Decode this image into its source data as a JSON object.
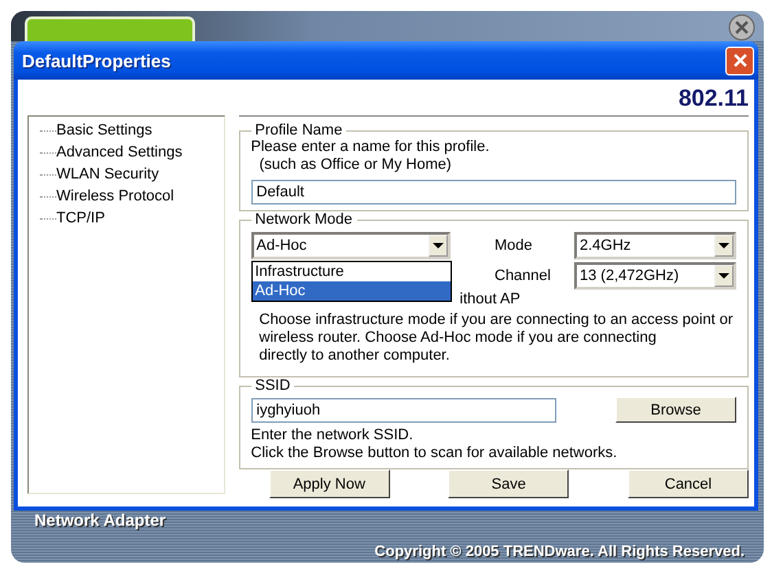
{
  "window": {
    "title": "DefaultProperties",
    "standard": "802.11"
  },
  "sidebar": {
    "items": [
      {
        "label": "Basic Settings"
      },
      {
        "label": "Advanced Settings"
      },
      {
        "label": "WLAN Security"
      },
      {
        "label": "Wireless Protocol"
      },
      {
        "label": "TCP/IP"
      }
    ]
  },
  "profile_name": {
    "legend": "Profile Name",
    "hint_lines": [
      "Please enter a name for this profile.",
      "  (such as Office or My Home)"
    ],
    "value": "Default"
  },
  "network_mode": {
    "legend": "Network Mode",
    "value": "Ad-Hoc",
    "options": [
      {
        "label": "Infrastructure",
        "selected": false
      },
      {
        "label": "Ad-Hoc",
        "selected": true
      }
    ],
    "covered_text": "ithout AP",
    "mode": {
      "label": "Mode",
      "value": "2.4GHz"
    },
    "channel": {
      "label": "Channel",
      "value": "13 (2,472GHz)"
    },
    "description_lines": [
      "Choose infrastructure mode if you are connecting to an access point or",
      "wireless router. Choose Ad-Hoc mode if you are connecting",
      "directly to another computer."
    ]
  },
  "ssid": {
    "legend": "SSID",
    "value": "iyghyiuoh",
    "browse": "Browse",
    "help_lines": [
      "Enter the network SSID.",
      "Click the Browse button to scan for available networks."
    ]
  },
  "buttons": [
    "Apply Now",
    "Save",
    "Cancel"
  ],
  "app": {
    "name": "Network Adapter",
    "copyright": "Copyright © 2005 TRENDware. All Rights Reserved."
  }
}
